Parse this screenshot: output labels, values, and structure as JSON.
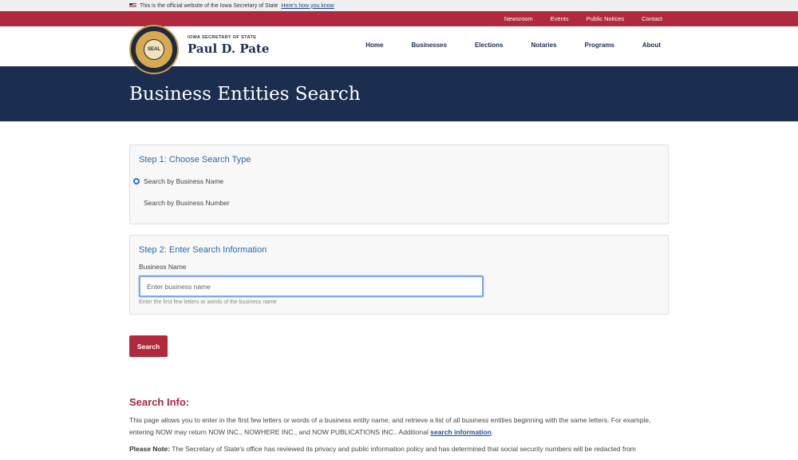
{
  "gov_banner": {
    "text": "This is the official website of the Iowa Secretary of State",
    "link": "Here's how you know"
  },
  "utility_nav": [
    "Newsroom",
    "Events",
    "Public Notices",
    "Contact"
  ],
  "seal": {
    "text": "SEAL",
    "colors": {
      "outer": "#1e2a44",
      "gold": "#d9a94d"
    }
  },
  "brand": {
    "kicker": "IOWA SECRETARY OF STATE",
    "name": "Paul D. Pate"
  },
  "main_nav": [
    "Home",
    "Businesses",
    "Elections",
    "Notaries",
    "Programs",
    "About"
  ],
  "hero": {
    "title": "Business Entities Search"
  },
  "step1": {
    "title": "Step 1: Choose Search Type",
    "options": [
      {
        "label": "Search by Business Name",
        "checked": true
      },
      {
        "label": "Search by Business Number",
        "checked": false
      }
    ]
  },
  "step2": {
    "title": "Step 2: Enter Search Information",
    "field_label": "Business Name",
    "input_value": "",
    "input_placeholder": "Enter business name",
    "hint": "Enter the first few letters or words of the business name"
  },
  "search_button": "Search",
  "info": {
    "heading": "Search Info:",
    "p1": "This page allows you to enter in the first few letters or words of a business entity name, and retrieve a list of all business entities beginning with the same letters. For example, entering NOW may return NOW INC., NOWHERE INC., and NOW PUBLICATIONS INC.. Additional",
    "p1_link": "search information",
    "p1_end": ".",
    "p2_label": "Please Note:",
    "p2": "The Secretary of State's office has reviewed its privacy and public information policy and has determined that social security numbers will be redacted from"
  },
  "colors": {
    "accent_red": "#b0293c",
    "navy": "#1c2e4f",
    "step_blue": "#2b6aa4"
  }
}
